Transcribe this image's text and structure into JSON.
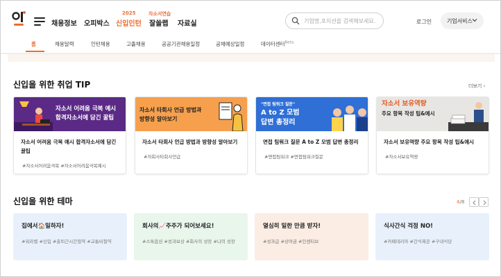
{
  "logo": {
    "text": "인",
    "color": "#f06a2a"
  },
  "gnb": {
    "items": [
      {
        "label": "채용정보",
        "sup": ""
      },
      {
        "label": "오피박스",
        "sup": ""
      },
      {
        "label": "신입인턴",
        "sup": "2025"
      },
      {
        "label": "잘쓸랩",
        "sup": "자소서연습"
      },
      {
        "label": "자료실",
        "sup": ""
      }
    ],
    "search_placeholder": "기업명,포지션을 검색해보세요.",
    "login": "로그인",
    "biz_service": "기업서비스"
  },
  "subnav": {
    "items": [
      "홈",
      "채용달력",
      "인턴채용",
      "고졸채용",
      "공공기관채용일정",
      "공채예상일정",
      "데이터센터"
    ],
    "beta": "Beta"
  },
  "tips": {
    "title": "신입을 위한 취업 TIP",
    "more": "더보기",
    "cards": [
      {
        "thumb_lines": [
          "자소서 어려움 극복 예시",
          "합격자소서에 담긴 꿀팁"
        ],
        "title": "자소서 어려움 극복 예시 합격자소서에 담긴 꿀팁",
        "tags": "#자소서어려움극복 #자소서어려움극복예시",
        "bg": "#5b2a86"
      },
      {
        "thumb_lines": [
          "자소서 타회사 언급 방법과",
          "방향성 알아보기"
        ],
        "title": "자소서 타회사 언급 방법과 방향성 알아보기",
        "tags": "#자회사타회사언급",
        "bg": "#f6a04d"
      },
      {
        "thumb_lines": [
          "\"면접 팀워크 질문\"",
          "A to Z 모범",
          "답변 총정리"
        ],
        "title": "면접 팀워크 질문 A to Z 모범 답변 총정리",
        "tags": "#면접팀워크 #면접팀워크질문",
        "bg": "#2f6fd6"
      },
      {
        "thumb_lines": [
          "자소서 보유역량",
          "주요 항목 작성 팁&예시"
        ],
        "title": "자소서 보유역량 주요 항목 작성 팁&예시",
        "tags": "#자소서보유역량",
        "bg": "#e8e6e3"
      }
    ]
  },
  "themes": {
    "title": "신입을 위한 테마",
    "page_current": "4",
    "page_total": "/8",
    "cards": [
      {
        "title": "집에서🏠일하자!",
        "tags": "#워라벨 #신입 #출퇴근시간절약 #교통비절약",
        "bg": "#e8f1fb"
      },
      {
        "title": "회사의📈주주가 되어보세요!",
        "tags": "#스톡옵션 #성과보상 #회사의 성장 #나의 성장",
        "bg": "#e9f6ec"
      },
      {
        "title": "열심히 일한 만큼 받자!",
        "tags": "#성과급 #상여금 #인센티브",
        "bg": "#fbece4"
      },
      {
        "title": "식사간식 걱정 NO!",
        "tags": "#카페테리아 #간식제공 #구내식당",
        "bg": "#e8f1fb"
      }
    ]
  },
  "colors": {
    "accent": "#f06a2a"
  }
}
